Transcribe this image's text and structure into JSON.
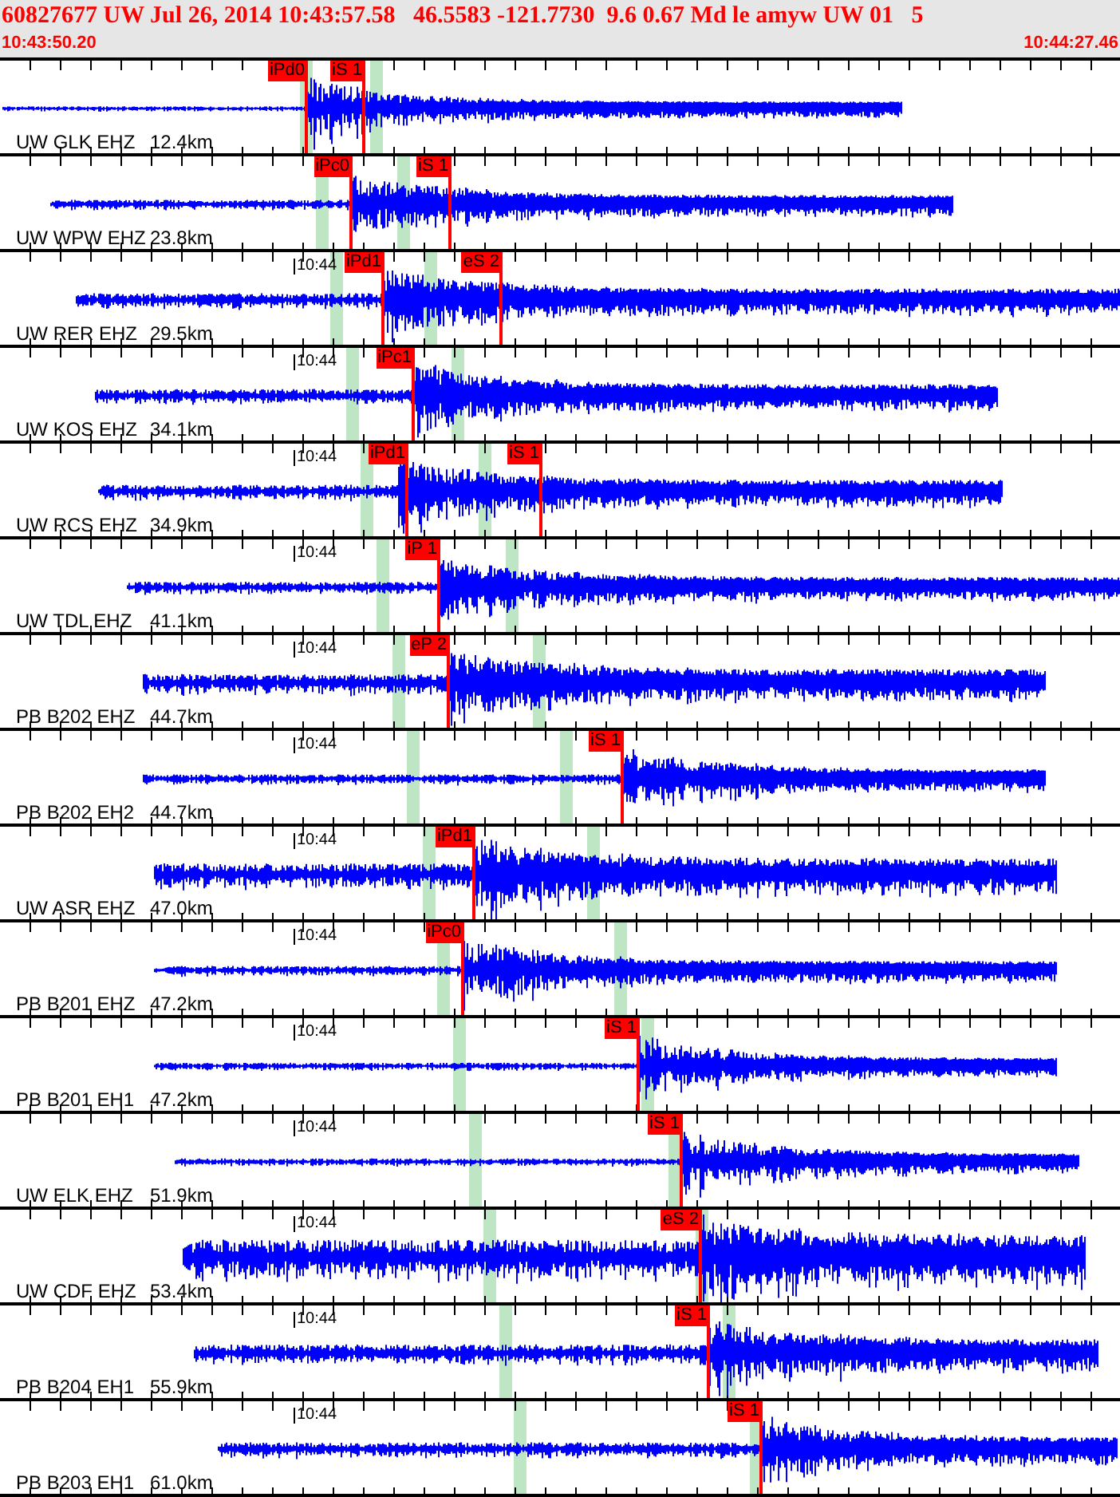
{
  "header": {
    "title": "60827677 UW Jul 26, 2014 10:43:57.58   46.5583 -121.7730  9.6 0.67 Md le amyw UW 01   5",
    "start_time": "10:43:50.20",
    "end_time": "10:44:27.46"
  },
  "traces": [
    {
      "station": "UW GLK EHZ",
      "distance": "12.4km",
      "picks": [
        {
          "label": "iPd0"
        },
        {
          "label": "iS 1"
        }
      ]
    },
    {
      "station": "UW WPW EHZ",
      "distance": "23.8km",
      "picks": [
        {
          "label": "iPc0"
        },
        {
          "label": "iS 1"
        }
      ]
    },
    {
      "station": "UW RER EHZ",
      "distance": "29.5km",
      "time_label": "10:44",
      "picks": [
        {
          "label": "iPd1"
        },
        {
          "label": "eS 2"
        }
      ]
    },
    {
      "station": "UW KOS EHZ",
      "distance": "34.1km",
      "time_label": "10:44",
      "picks": [
        {
          "label": "iPc1"
        }
      ]
    },
    {
      "station": "UW RCS EHZ",
      "distance": "34.9km",
      "time_label": "10:44",
      "picks": [
        {
          "label": "iPd1"
        },
        {
          "label": "iS 1"
        }
      ]
    },
    {
      "station": "UW TDL EHZ",
      "distance": "41.1km",
      "time_label": "10:44",
      "picks": [
        {
          "label": "iP 1"
        }
      ]
    },
    {
      "station": "PB B202 EHZ",
      "distance": "44.7km",
      "time_label": "10:44",
      "picks": [
        {
          "label": "eP 2"
        }
      ]
    },
    {
      "station": "PB B202 EH2",
      "distance": "44.7km",
      "time_label": "10:44",
      "picks": [
        {
          "label": "iS 1"
        }
      ]
    },
    {
      "station": "UW ASR EHZ",
      "distance": "47.0km",
      "time_label": "10:44",
      "picks": [
        {
          "label": "iPd1"
        }
      ]
    },
    {
      "station": "PB B201 EHZ",
      "distance": "47.2km",
      "time_label": "10:44",
      "picks": [
        {
          "label": "iPc0"
        }
      ]
    },
    {
      "station": "PB B201 EH1",
      "distance": "47.2km",
      "time_label": "10:44",
      "picks": [
        {
          "label": "iS 1"
        }
      ]
    },
    {
      "station": "UW ELK EHZ",
      "distance": "51.9km",
      "time_label": "10:44",
      "picks": [
        {
          "label": "iS 1"
        }
      ]
    },
    {
      "station": "UW CDF EHZ",
      "distance": "53.4km",
      "time_label": "10:44",
      "picks": [
        {
          "label": "eS 2"
        }
      ]
    },
    {
      "station": "PB B204 EH1",
      "distance": "55.9km",
      "time_label": "10:44",
      "picks": [
        {
          "label": "iS 1"
        }
      ]
    },
    {
      "station": "PB B203 EH1",
      "distance": "61.0km",
      "time_label": "10:44",
      "picks": [
        {
          "label": "iS 1"
        }
      ]
    }
  ]
}
